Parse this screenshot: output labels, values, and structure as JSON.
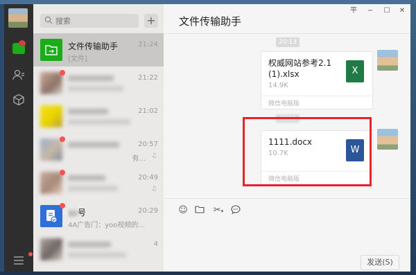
{
  "search": {
    "placeholder": "搜索",
    "add_label": "+"
  },
  "conversations": [
    {
      "name": "文件传输助手",
      "time": "21:24",
      "preview": "[文件]",
      "active": true
    },
    {
      "name": "",
      "time": "21:22",
      "preview": ""
    },
    {
      "name": "",
      "time": "21:02",
      "preview": ""
    },
    {
      "name": "",
      "time": "20:57",
      "preview": "有..."
    },
    {
      "name": "",
      "time": "20:49",
      "preview": ""
    },
    {
      "name": "号",
      "time": "20:29",
      "preview": "4A广告门：yoo视频的..."
    },
    {
      "name": "",
      "time": "4",
      "preview": ""
    }
  ],
  "chat": {
    "title": "文件传输助手",
    "timestamp": "20:13",
    "timestamp2": "1111",
    "files": [
      {
        "name": "权威网站参考2.1(1).xlsx",
        "size": "14.9K",
        "source": "微信电脑版",
        "type_icon": "X"
      },
      {
        "name": "1111.docx",
        "size": "10.7K",
        "source": "微信电脑版",
        "type_icon": "W"
      }
    ]
  },
  "window": {
    "pin": "平",
    "minimize": "−",
    "maximize": "☐",
    "close": "✕"
  },
  "toolbar": {
    "emoji": "☺",
    "folder": "▭",
    "scissors": "✂",
    "chat_history": "◌"
  },
  "send_label": "发送(S)",
  "colors": {
    "accent": "#1aad19",
    "highlight_box": "#e8202a",
    "badge": "#fa5151",
    "excel": "#1f7a45",
    "word": "#2b579a"
  }
}
